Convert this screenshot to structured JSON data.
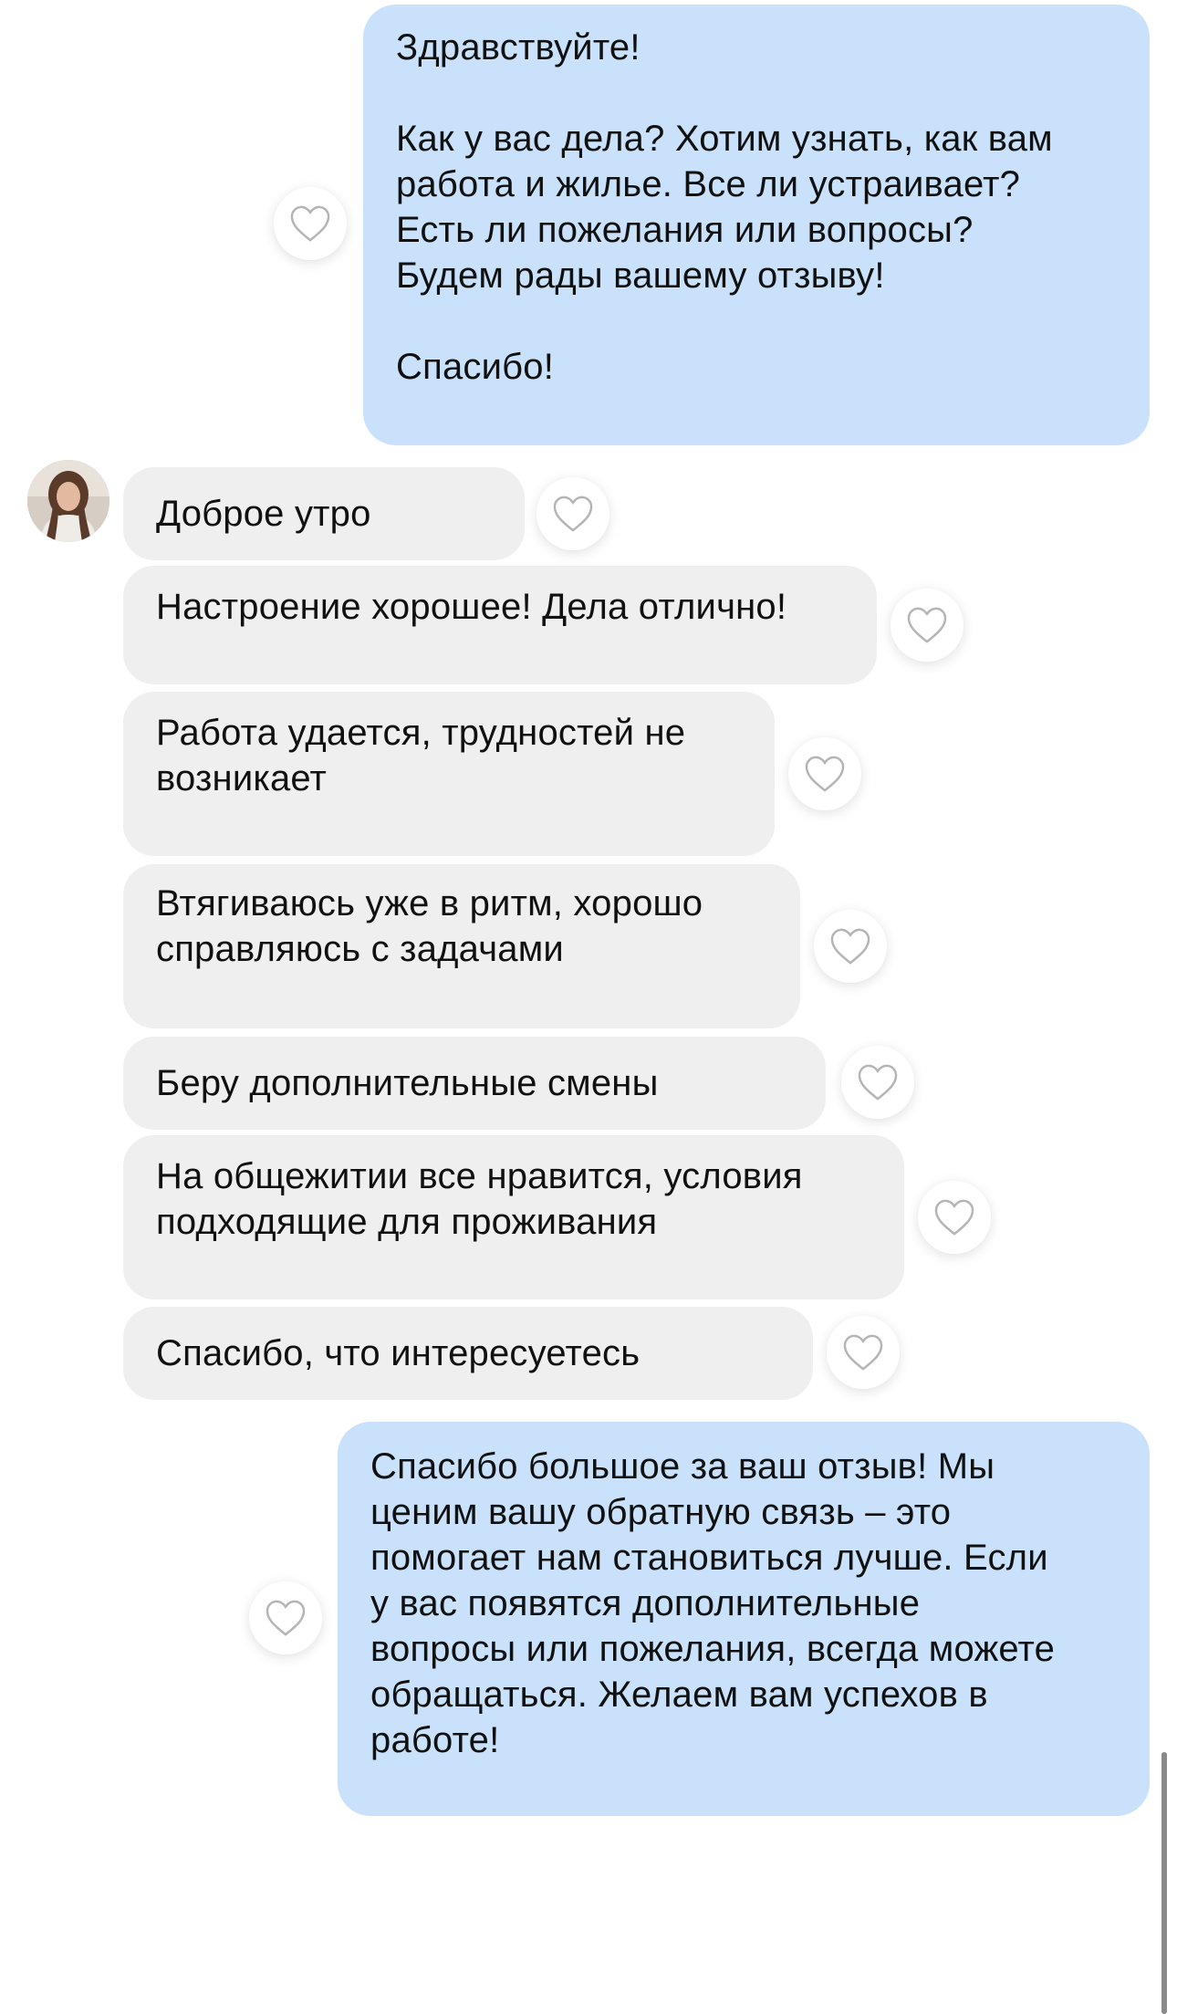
{
  "conversation": {
    "messages": [
      {
        "direction": "out",
        "text": "Здравствуйте!\n\nКак у вас дела? Хотим узнать, как вам\nработа и жилье. Все ли устраивает?\nЕсть ли пожелания или вопросы?\nБудем рады вашему отзыву!\n\nСпасибо!"
      },
      {
        "direction": "in",
        "text": "Доброе утро"
      },
      {
        "direction": "in",
        "text": "Настроение хорошее! Дела отлично!"
      },
      {
        "direction": "in",
        "text": "Работа удается, трудностей не\nвозникает"
      },
      {
        "direction": "in",
        "text": "Втягиваюсь уже в ритм, хорошо\nсправляюсь с задачами"
      },
      {
        "direction": "in",
        "text": "Беру дополнительные смены"
      },
      {
        "direction": "in",
        "text": "На общежитии все нравится, условия\nподходящие для проживания"
      },
      {
        "direction": "in",
        "text": "Спасибо, что интересуетесь"
      },
      {
        "direction": "out",
        "text": "Спасибо большое за ваш отзыв! Мы\nценим вашу обратную связь – это\nпомогает нам становиться лучше. Если\nу вас появятся дополнительные\nвопросы или пожелания, всегда можете\nобращаться. Желаем вам успехов в\nработе!"
      }
    ]
  },
  "icons": {
    "like": "heart-outline-icon",
    "avatar": "contact-avatar-photo"
  },
  "colors": {
    "outgoing_bubble": "#c9e1fb",
    "incoming_bubble": "#efefef",
    "heart_stroke": "#b5b5b5"
  }
}
